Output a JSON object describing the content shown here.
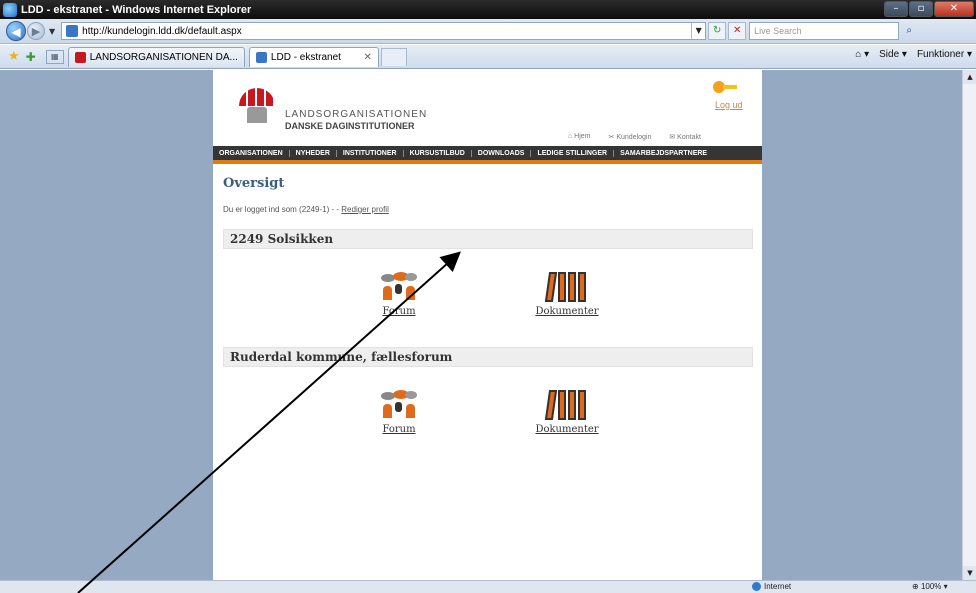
{
  "window": {
    "title": "LDD - ekstranet - Windows Internet Explorer"
  },
  "toolbar": {
    "url": "http://kundelogin.ldd.dk/default.aspx",
    "search_placeholder": "Live Search"
  },
  "tabs": [
    {
      "label": "LANDSORGANISATIONEN DA..."
    },
    {
      "label": "LDD - ekstranet"
    }
  ],
  "command_bar": {
    "home": "⌂ ▾",
    "side": "Side ▾",
    "funktioner": "Funktioner ▾"
  },
  "site": {
    "org_line1": "LANDSORGANISATIONEN",
    "org_line2": "DANSKE DAGINSTITUTIONER",
    "logout": "Log ud",
    "toplinks": [
      "⌂ Hjem",
      "✂ Kundelogin",
      "✉ Kontakt"
    ],
    "menu": [
      "ORGANISATIONEN",
      "NYHEDER",
      "INSTITUTIONER",
      "KURSUSTILBUD",
      "DOWNLOADS",
      "LEDIGE STILLINGER",
      "SAMARBEJDSPARTNERE"
    ]
  },
  "main": {
    "heading": "Oversigt",
    "logged_in_text": "Du er logget ind som (2249-1) - - ",
    "edit_profile": "Rediger profil",
    "sections": [
      {
        "title": "2249 Solsikken",
        "tiles": [
          "Forum",
          "Dokumenter"
        ]
      },
      {
        "title": "Ruderdal kommune, fællesforum",
        "tiles": [
          "Forum",
          "Dokumenter"
        ]
      }
    ]
  },
  "statusbar": {
    "zone": "Internet",
    "zoom": "100%"
  },
  "colors": {
    "menu_bg": "#353535",
    "accent_orange": "#e07b12",
    "side_bg": "#95a9c2",
    "heading_blue": "#3d5c80"
  }
}
